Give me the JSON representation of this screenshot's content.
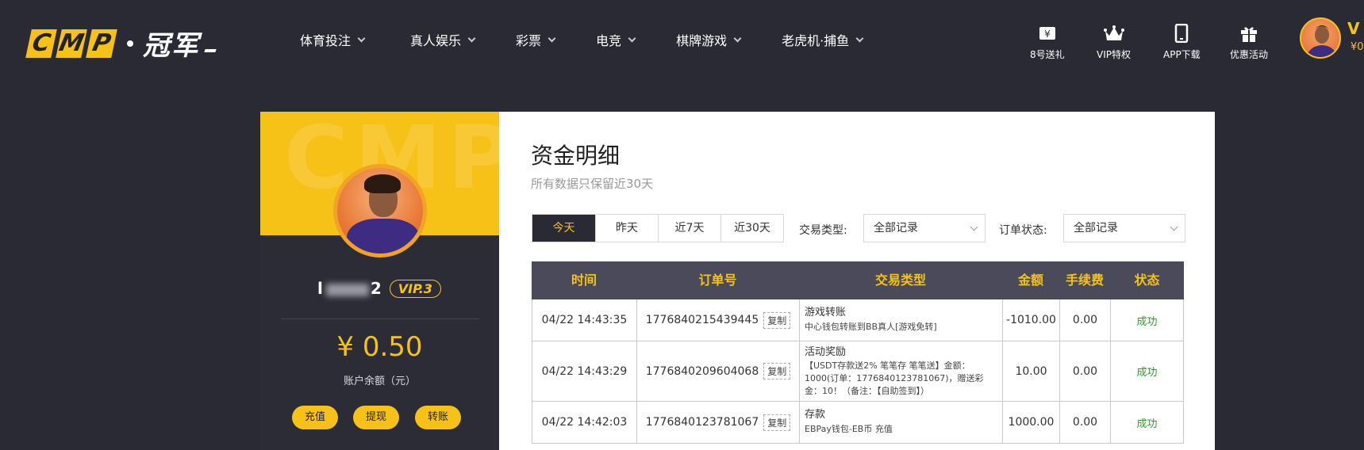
{
  "header": {
    "logo_letters": [
      "C",
      "M",
      "P"
    ],
    "logo_cn": "冠军",
    "nav": [
      {
        "label": "体育投注"
      },
      {
        "label": "真人娱乐"
      },
      {
        "label": "彩票"
      },
      {
        "label": "电竞"
      },
      {
        "label": "棋牌游戏"
      },
      {
        "label": "老虎机·捕鱼"
      }
    ],
    "quick_links": [
      {
        "label": "8号送礼",
        "icon": "gift-ticket-icon"
      },
      {
        "label": "VIP特权",
        "icon": "crown-icon"
      },
      {
        "label": "APP下载",
        "icon": "phone-icon"
      },
      {
        "label": "优惠活动",
        "icon": "gift-box-icon"
      }
    ],
    "user_initial": "V",
    "user_balance_prefix": "¥0"
  },
  "profile": {
    "watermark": "CMP",
    "username_start": "l",
    "username_end": "2",
    "vip": "VIP.3",
    "balance": "¥ 0.50",
    "balance_label": "账户余额（元）",
    "actions": [
      "充值",
      "提现",
      "转账"
    ]
  },
  "main": {
    "title": "资金明细",
    "subtitle": "所有数据只保留近30天",
    "tabs": [
      {
        "label": "今天",
        "active": true
      },
      {
        "label": "昨天",
        "active": false
      },
      {
        "label": "近7天",
        "active": false
      },
      {
        "label": "近30天",
        "active": false
      }
    ],
    "filter_type_label": "交易类型:",
    "filter_type_value": "全部记录",
    "filter_status_label": "订单状态:",
    "filter_status_value": "全部记录",
    "table": {
      "headers": [
        "时间",
        "订单号",
        "交易类型",
        "金额",
        "手续费",
        "状态"
      ],
      "copy_label": "复制",
      "rows": [
        {
          "time": "04/22 14:43:35",
          "order": "1776840215439445",
          "type_main": "游戏转账",
          "type_sub": "中心钱包转账到BB真人[游戏免转]",
          "amount": "-1010.00",
          "fee": "0.00",
          "status": "成功"
        },
        {
          "time": "04/22 14:43:29",
          "order": "1776840209604068",
          "type_main": "活动奖励",
          "type_sub": "【USDT存款送2% 笔笔存 笔笔送】金额：1000(订单：1776840123781067)，赠送彩金：10！（备注：【自助签到】）",
          "amount": "10.00",
          "fee": "0.00",
          "status": "成功"
        },
        {
          "time": "04/22 14:42:03",
          "order": "1776840123781067",
          "type_main": "存款",
          "type_sub": "EBPay钱包-EB币 充值",
          "amount": "1000.00",
          "fee": "0.00",
          "status": "成功"
        }
      ]
    }
  },
  "colors": {
    "accent": "#f7c218",
    "dark_bg": "#2a2a35",
    "table_head": "#4a4a5a",
    "success": "#2f9a2f"
  }
}
